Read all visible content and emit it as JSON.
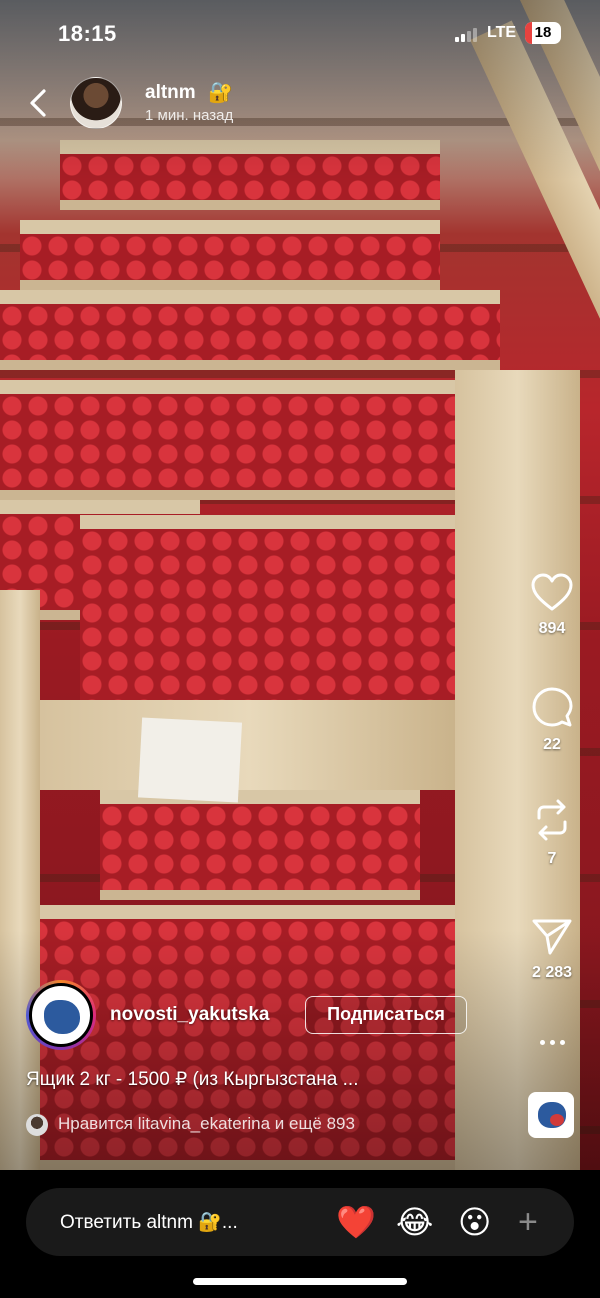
{
  "status_bar": {
    "time": "18:15",
    "network": "LTE",
    "battery": "18",
    "battery_color": "#e8423f"
  },
  "story_header": {
    "username": "altnm",
    "lock_emoji": "🔐",
    "posted": "1 мин. назад"
  },
  "actions": {
    "likes": "894",
    "comments": "22",
    "reposts": "7",
    "shares": "2 283"
  },
  "reel": {
    "username": "novosti_yakutska",
    "follow_label": "Подписаться",
    "caption": "Ящик 2 кг - 1500 ₽ (из Кыргызстана ...",
    "liked_by": "Нравится litavina_ekaterina и ещё 893"
  },
  "reply_bar": {
    "placeholder": "Ответить altnm 🔐...",
    "emoji_1": "❤️",
    "emoji_2": "😂",
    "emoji_3": "😮",
    "add": "+"
  },
  "icons": [
    "back-chevron-icon",
    "heart-icon",
    "comment-icon",
    "repost-icon",
    "send-icon",
    "more-icon",
    "plus-icon"
  ]
}
